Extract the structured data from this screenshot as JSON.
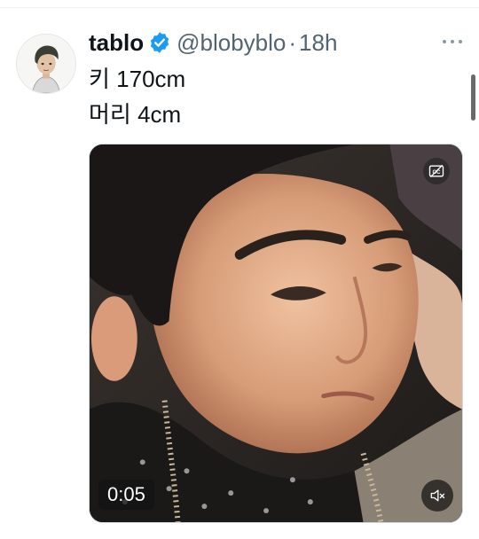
{
  "tweet": {
    "author_name": "tablo",
    "handle": "@blobyblo",
    "separator": "·",
    "time": "18h",
    "lines": [
      "키 170cm",
      "머리 4cm"
    ]
  },
  "media": {
    "duration": "0:05"
  },
  "icons": {
    "verified": "verified-badge-icon",
    "more": "more-icon",
    "captions": "closed-captions-icon",
    "mute": "volume-muted-icon"
  },
  "colors": {
    "verified": "#1d9bf0",
    "text": "#0f1419",
    "secondary": "#536471"
  }
}
